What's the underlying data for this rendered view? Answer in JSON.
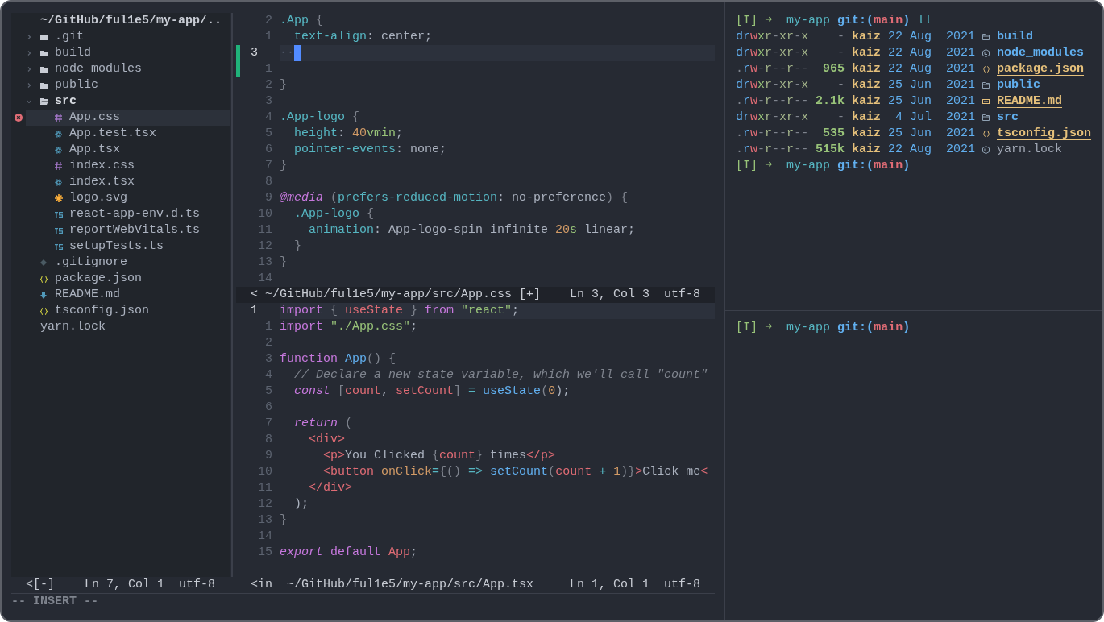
{
  "file_tree": {
    "header": "~/GitHub/ful1e5/my-app/..",
    "items": [
      {
        "name": ".git",
        "kind": "folder",
        "expanded": false,
        "selected": false,
        "error": false
      },
      {
        "name": "build",
        "kind": "folder",
        "expanded": false,
        "selected": false,
        "error": false
      },
      {
        "name": "node_modules",
        "kind": "folder",
        "expanded": false,
        "selected": false,
        "error": false
      },
      {
        "name": "public",
        "kind": "folder",
        "expanded": false,
        "selected": false,
        "error": false
      },
      {
        "name": "src",
        "kind": "folder",
        "expanded": true,
        "selected": false,
        "error": false,
        "children": [
          {
            "name": "App.css",
            "kind": "css",
            "selected": true,
            "error": true
          },
          {
            "name": "App.test.tsx",
            "kind": "react",
            "selected": false,
            "error": false
          },
          {
            "name": "App.tsx",
            "kind": "react",
            "selected": false,
            "error": false
          },
          {
            "name": "index.css",
            "kind": "css",
            "selected": false,
            "error": false
          },
          {
            "name": "index.tsx",
            "kind": "react",
            "selected": false,
            "error": false
          },
          {
            "name": "logo.svg",
            "kind": "svg",
            "selected": false,
            "error": false
          },
          {
            "name": "react-app-env.d.ts",
            "kind": "ts",
            "selected": false,
            "error": false
          },
          {
            "name": "reportWebVitals.ts",
            "kind": "ts",
            "selected": false,
            "error": false
          },
          {
            "name": "setupTests.ts",
            "kind": "ts",
            "selected": false,
            "error": false
          }
        ]
      },
      {
        "name": ".gitignore",
        "kind": "git",
        "selected": false,
        "error": false
      },
      {
        "name": "package.json",
        "kind": "json",
        "selected": false,
        "error": false
      },
      {
        "name": "README.md",
        "kind": "markdown",
        "selected": false,
        "error": false
      },
      {
        "name": "tsconfig.json",
        "kind": "json",
        "selected": false,
        "error": false
      },
      {
        "name": "yarn.lock",
        "kind": "plain",
        "selected": false,
        "error": false
      }
    ],
    "status": {
      "left": [
        "<[-]"
      ],
      "right": [
        "Ln 7, Col 1",
        "utf-8"
      ]
    }
  },
  "editor_panes": [
    {
      "lines": [
        {
          "number": "2",
          "current": false,
          "git_added": false,
          "tokens": [
            {
              "text": ".App",
              "kind": "selector"
            },
            {
              "text": " {",
              "kind": "punct"
            }
          ]
        },
        {
          "number": "1",
          "current": false,
          "git_added": false,
          "tokens": [
            {
              "text": "  text-align",
              "kind": "property"
            },
            {
              "text": ": center;",
              "kind": "plain"
            }
          ]
        },
        {
          "number": "3",
          "current": true,
          "git_added": true,
          "cursor": true,
          "tokens": [
            {
              "text": "··",
              "kind": "whitespace"
            }
          ]
        },
        {
          "number": "1",
          "current": false,
          "git_added": true
        },
        {
          "number": "2",
          "current": false,
          "git_added": false,
          "tokens": [
            {
              "text": "}",
              "kind": "punct"
            }
          ]
        },
        {
          "number": "3",
          "current": false,
          "git_added": false
        },
        {
          "number": "4",
          "current": false,
          "git_added": false,
          "tokens": [
            {
              "text": ".App-logo",
              "kind": "selector"
            },
            {
              "text": " {",
              "kind": "punct"
            }
          ]
        },
        {
          "number": "5",
          "current": false,
          "git_added": false,
          "tokens": [
            {
              "text": "  height",
              "kind": "property"
            },
            {
              "text": ": ",
              "kind": "plain"
            },
            {
              "text": "40",
              "kind": "number"
            },
            {
              "text": "vmin",
              "kind": "unit"
            },
            {
              "text": ";",
              "kind": "plain"
            }
          ]
        },
        {
          "number": "6",
          "current": false,
          "git_added": false,
          "tokens": [
            {
              "text": "  pointer-events",
              "kind": "property"
            },
            {
              "text": ": none;",
              "kind": "plain"
            }
          ]
        },
        {
          "number": "7",
          "current": false,
          "git_added": false,
          "tokens": [
            {
              "text": "}",
              "kind": "punct"
            }
          ]
        },
        {
          "number": "8",
          "current": false,
          "git_added": false
        },
        {
          "number": "9",
          "current": false,
          "git_added": false,
          "tokens": [
            {
              "text": "@media",
              "kind": "at-rule"
            },
            {
              "text": " (",
              "kind": "punct"
            },
            {
              "text": "prefers-reduced-motion",
              "kind": "property"
            },
            {
              "text": ": no-preference",
              "kind": "plain"
            },
            {
              "text": ") {",
              "kind": "punct"
            }
          ]
        },
        {
          "number": "10",
          "current": false,
          "git_added": false,
          "tokens": [
            {
              "text": "  .App-logo",
              "kind": "selector"
            },
            {
              "text": " {",
              "kind": "punct"
            }
          ]
        },
        {
          "number": "11",
          "current": false,
          "git_added": false,
          "tokens": [
            {
              "text": "    animation",
              "kind": "property"
            },
            {
              "text": ": App-logo-spin infinite ",
              "kind": "plain"
            },
            {
              "text": "20",
              "kind": "number"
            },
            {
              "text": "s",
              "kind": "unit"
            },
            {
              "text": " linear;",
              "kind": "plain"
            }
          ]
        },
        {
          "number": "12",
          "current": false,
          "git_added": false,
          "tokens": [
            {
              "text": "  }",
              "kind": "punct"
            }
          ]
        },
        {
          "number": "13",
          "current": false,
          "git_added": false,
          "tokens": [
            {
              "text": "}",
              "kind": "punct"
            }
          ]
        },
        {
          "number": "14",
          "current": false,
          "git_added": false
        }
      ],
      "status": {
        "left": [
          "< ~/GitHub/ful1e5/my-app/src/App.css [+]"
        ],
        "right": [
          "Ln 3, Col 3",
          "utf-8"
        ]
      }
    },
    {
      "lines": [
        {
          "number": "1",
          "current": true,
          "git_added": false,
          "tokens": [
            {
              "text": "import",
              "kind": "keyword"
            },
            {
              "text": " { ",
              "kind": "punct"
            },
            {
              "text": "useState",
              "kind": "variable"
            },
            {
              "text": " } ",
              "kind": "punct"
            },
            {
              "text": "from ",
              "kind": "keyword"
            },
            {
              "text": "\"react\"",
              "kind": "string"
            },
            {
              "text": ";",
              "kind": "plain"
            }
          ]
        },
        {
          "number": "1",
          "current": false,
          "git_added": false,
          "tokens": [
            {
              "text": "import ",
              "kind": "keyword"
            },
            {
              "text": "\"./App.css\"",
              "kind": "string"
            },
            {
              "text": ";",
              "kind": "plain"
            }
          ]
        },
        {
          "number": "2",
          "current": false,
          "git_added": false
        },
        {
          "number": "3",
          "current": false,
          "git_added": false,
          "tokens": [
            {
              "text": "function ",
              "kind": "keyword"
            },
            {
              "text": "App",
              "kind": "function"
            },
            {
              "text": "() {",
              "kind": "punct"
            }
          ]
        },
        {
          "number": "4",
          "current": false,
          "git_added": false,
          "tokens": [
            {
              "text": "  // Declare a new state variable, which we'll call \"count\"",
              "kind": "comment"
            }
          ]
        },
        {
          "number": "5",
          "current": false,
          "git_added": false,
          "tokens": [
            {
              "text": "  const",
              "kind": "keyword-italic"
            },
            {
              "text": " [",
              "kind": "punct"
            },
            {
              "text": "count",
              "kind": "variable"
            },
            {
              "text": ", ",
              "kind": "plain"
            },
            {
              "text": "setCount",
              "kind": "variable"
            },
            {
              "text": "] ",
              "kind": "punct"
            },
            {
              "text": "= ",
              "kind": "operator"
            },
            {
              "text": "useState",
              "kind": "function"
            },
            {
              "text": "(",
              "kind": "punct"
            },
            {
              "text": "0",
              "kind": "number"
            },
            {
              "text": ");",
              "kind": "plain"
            }
          ]
        },
        {
          "number": "6",
          "current": false,
          "git_added": false
        },
        {
          "number": "7",
          "current": false,
          "git_added": false,
          "tokens": [
            {
              "text": "  return",
              "kind": "keyword-italic"
            },
            {
              "text": " (",
              "kind": "punct"
            }
          ]
        },
        {
          "number": "8",
          "current": false,
          "git_added": false,
          "tokens": [
            {
              "text": "    <div>",
              "kind": "tag"
            }
          ]
        },
        {
          "number": "9",
          "current": false,
          "git_added": false,
          "tokens": [
            {
              "text": "      <p>",
              "kind": "tag"
            },
            {
              "text": "You Clicked ",
              "kind": "plain"
            },
            {
              "text": "{",
              "kind": "punct"
            },
            {
              "text": "count",
              "kind": "variable"
            },
            {
              "text": "}",
              "kind": "punct"
            },
            {
              "text": " times",
              "kind": "plain"
            },
            {
              "text": "</p>",
              "kind": "tag"
            }
          ]
        },
        {
          "number": "10",
          "current": false,
          "git_added": false,
          "tokens": [
            {
              "text": "      <button ",
              "kind": "tag"
            },
            {
              "text": "onClick",
              "kind": "attribute"
            },
            {
              "text": "=",
              "kind": "operator"
            },
            {
              "text": "{() ",
              "kind": "punct"
            },
            {
              "text": "=> ",
              "kind": "operator"
            },
            {
              "text": "setCount",
              "kind": "function"
            },
            {
              "text": "(",
              "kind": "punct"
            },
            {
              "text": "count ",
              "kind": "variable"
            },
            {
              "text": "+ ",
              "kind": "operator"
            },
            {
              "text": "1",
              "kind": "number"
            },
            {
              "text": ")}",
              "kind": "punct"
            },
            {
              "text": ">",
              "kind": "tag"
            },
            {
              "text": "Click me",
              "kind": "plain"
            },
            {
              "text": "<",
              "kind": "tag"
            }
          ]
        },
        {
          "number": "11",
          "current": false,
          "git_added": false,
          "tokens": [
            {
              "text": "    </div>",
              "kind": "tag"
            }
          ]
        },
        {
          "number": "12",
          "current": false,
          "git_added": false,
          "tokens": [
            {
              "text": "  );",
              "kind": "plain"
            }
          ]
        },
        {
          "number": "13",
          "current": false,
          "git_added": false,
          "tokens": [
            {
              "text": "}",
              "kind": "punct"
            }
          ]
        },
        {
          "number": "14",
          "current": false,
          "git_added": false
        },
        {
          "number": "15",
          "current": false,
          "git_added": false,
          "tokens": [
            {
              "text": "export",
              "kind": "keyword-italic"
            },
            {
              "text": " default ",
              "kind": "keyword"
            },
            {
              "text": "App",
              "kind": "variable"
            },
            {
              "text": ";",
              "kind": "plain"
            }
          ]
        }
      ],
      "status": {
        "left": [
          "<in",
          "~/GitHub/ful1e5/my-app/src/App.tsx"
        ],
        "right": [
          "Ln 1, Col 1",
          "utf-8"
        ]
      }
    }
  ],
  "command_line": "-- INSERT --",
  "terminal_panes": [
    {
      "lines": [
        {
          "kind": "prompt",
          "mode": "[I]",
          "arrow": "➜",
          "dir": "my-app",
          "git_open": "git:(",
          "branch": "main",
          "git_close": ")",
          "command": "ll"
        },
        {
          "kind": "dir",
          "permissions": "drwxr-xr-x",
          "size": "-",
          "owner": "kaiz",
          "date": "22 Aug",
          "year": "2021",
          "name": "build"
        },
        {
          "kind": "node-dir",
          "permissions": "drwxr-xr-x",
          "size": "-",
          "owner": "kaiz",
          "date": "22 Aug",
          "year": "2021",
          "name": "node_modules"
        },
        {
          "kind": "json",
          "permissions": ".rw-r--r--",
          "size": "965",
          "owner": "kaiz",
          "date": "22 Aug",
          "year": "2021",
          "name": "package.json"
        },
        {
          "kind": "dir",
          "permissions": "drwxr-xr-x",
          "size": "-",
          "owner": "kaiz",
          "date": "25 Jun",
          "year": "2021",
          "name": "public"
        },
        {
          "kind": "readme",
          "permissions": ".rw-r--r--",
          "size": "2.1k",
          "owner": "kaiz",
          "date": "25 Jun",
          "year": "2021",
          "name": "README.md"
        },
        {
          "kind": "dir",
          "permissions": "drwxr-xr-x",
          "size": "-",
          "owner": "kaiz",
          "date": "4 Jul",
          "year": "2021",
          "name": "src"
        },
        {
          "kind": "json",
          "permissions": ".rw-r--r--",
          "size": "535",
          "owner": "kaiz",
          "date": "25 Jun",
          "year": "2021",
          "name": "tsconfig.json"
        },
        {
          "kind": "lock",
          "permissions": ".rw-r--r--",
          "size": "515k",
          "owner": "kaiz",
          "date": "22 Aug",
          "year": "2021",
          "name": "yarn.lock"
        },
        {
          "kind": "prompt",
          "mode": "[I]",
          "arrow": "➜",
          "dir": "my-app",
          "git_open": "git:(",
          "branch": "main",
          "git_close": ")"
        }
      ]
    },
    {
      "lines": [
        {
          "kind": "prompt",
          "mode": "[I]",
          "arrow": "➜",
          "dir": "my-app",
          "git_open": "git:(",
          "branch": "main",
          "git_close": ")"
        }
      ]
    }
  ]
}
